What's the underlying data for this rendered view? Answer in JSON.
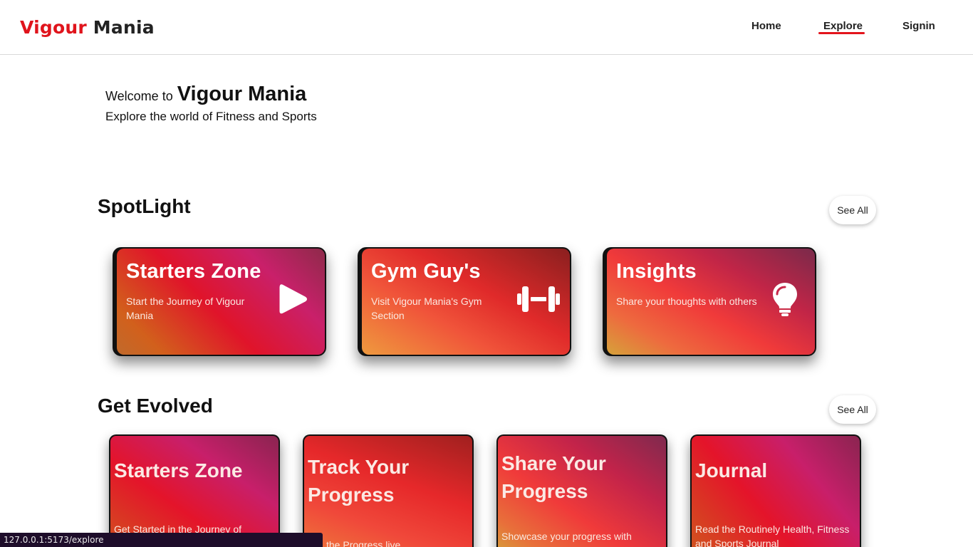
{
  "header": {
    "logo_part1": "Vigour",
    "logo_part2": "Mania",
    "nav": {
      "home": "Home",
      "explore": "Explore",
      "signin": "Signin"
    },
    "active_nav": "Explore"
  },
  "welcome": {
    "prefix": "Welcome to",
    "brand": "Vigour Mania",
    "tagline": "Explore the world of Fitness and Sports"
  },
  "spotlight": {
    "title": "SpotLight",
    "see_all": "See All",
    "cards": [
      {
        "title": "Starters Zone",
        "desc": "Start the Journey of Vigour Mania",
        "icon": "play-icon"
      },
      {
        "title": "Gym Guy's",
        "desc": "Visit Vigour Mania's Gym Section",
        "icon": "dumbbell-icon"
      },
      {
        "title": "Insights",
        "desc": "Share your thoughts with others",
        "icon": "lightbulb-icon"
      }
    ]
  },
  "evolved": {
    "title": "Get Evolved",
    "see_all": "See All",
    "cards": [
      {
        "title": "Starters Zone",
        "desc": "Get Started in the Journey of"
      },
      {
        "title_line1": "Track Your",
        "title_line2": "Progress",
        "desc": "the Progress live"
      },
      {
        "title_line1": "Share Your",
        "title_line2": "Progress",
        "desc": "Showcase your progress with"
      },
      {
        "title": "Journal",
        "desc": "Read the Routinely Health, Fitness and Sports Journal"
      }
    ]
  },
  "status_bar": {
    "url": "127.0.0.1:5173/explore"
  },
  "colors": {
    "brand_red": "#e0141c",
    "status_bar_bg": "#1e0d2a"
  }
}
